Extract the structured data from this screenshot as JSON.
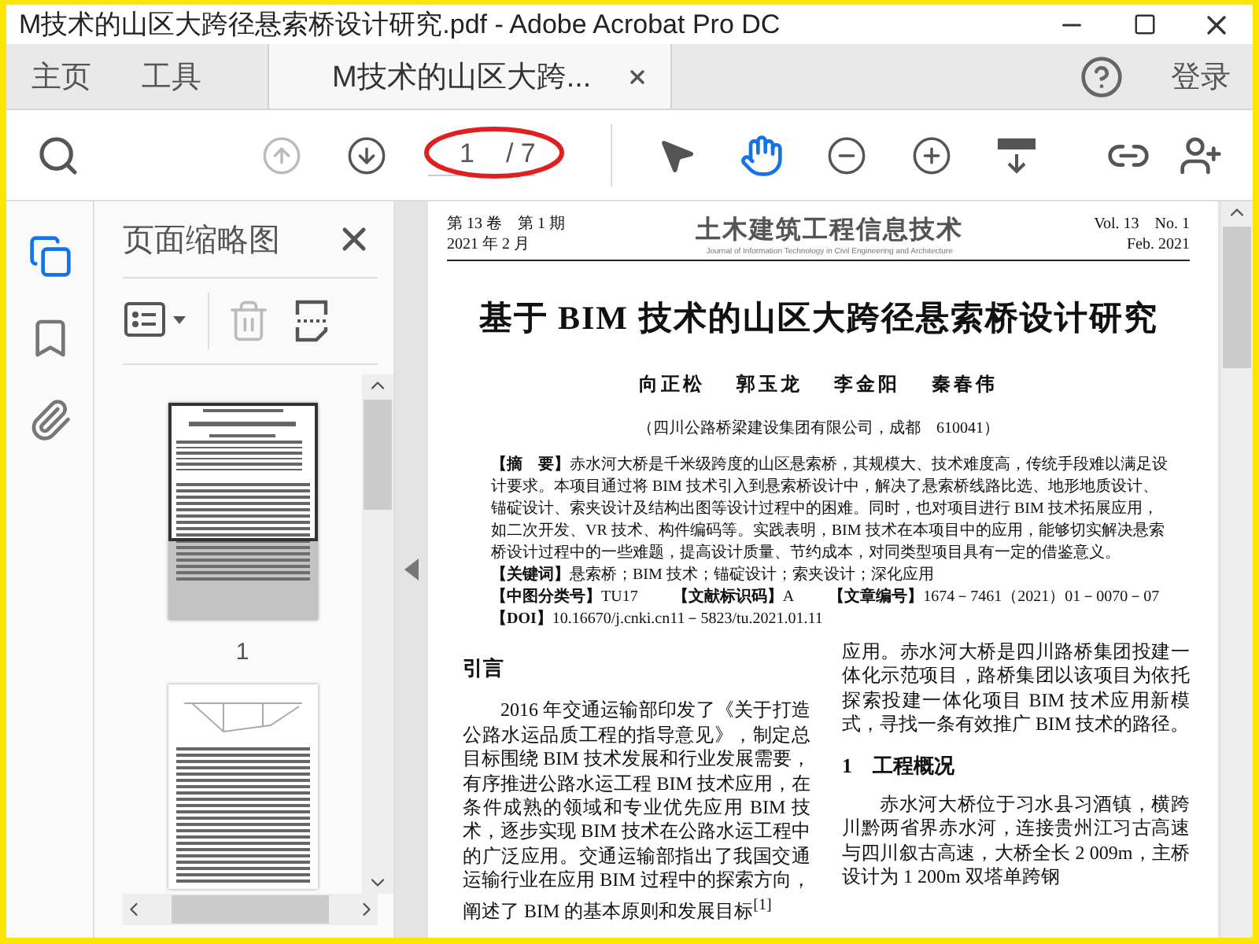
{
  "window": {
    "title": "M技术的山区大跨径悬索桥设计研究.pdf - Adobe Acrobat Pro DC"
  },
  "nav_tabs": [
    {
      "label": "主页",
      "selected": false
    },
    {
      "label": "工具",
      "selected": false
    },
    {
      "label": "M技术的山区大跨...",
      "selected": true
    }
  ],
  "account": {
    "label": "登录"
  },
  "page_navigation": [
    {
      "kind": "previous",
      "disabled": true
    },
    {
      "kind": "next",
      "disabled": false
    }
  ],
  "page_field": {
    "value": "1",
    "count": "/ 7"
  },
  "tools": [
    {
      "kind": "select",
      "selected": false
    },
    {
      "kind": "hand",
      "selected": true
    }
  ],
  "sidebar_tools": [
    {
      "kind": "pages",
      "selected": true
    },
    {
      "kind": "bookmarks",
      "selected": false
    },
    {
      "kind": "attachments",
      "selected": false
    }
  ],
  "thumbnails_panel": {
    "title": "页面缩略图",
    "pages": [
      {
        "kind": "title-page",
        "label": "1",
        "selected": true
      },
      {
        "kind": "figure-page",
        "selected": false
      }
    ]
  },
  "document": {
    "header_left": [
      "第 13 卷　第 1 期",
      "2021 年 2 月"
    ],
    "journal_title": "土木建筑工程信息技术",
    "journal_subtitle": "Journal of Information Technology in Civil Engineering and Architecture",
    "header_right": [
      "Vol. 13　No. 1",
      "Feb. 2021"
    ],
    "title": "基于 BIM 技术的山区大跨径悬索桥设计研究",
    "authors": [
      "向正松",
      "郭玉龙",
      "李金阳",
      "秦春伟"
    ],
    "affiliation": "（四川公路桥梁建设集团有限公司，成都　610041）",
    "abstract": "**【摘　要】**赤水河大桥是千米级跨度的山区悬索桥，其规模大、技术难度高，传统手段难以满足设计要求。本项目通过将 BIM 技术引入到悬索桥设计中，解决了悬索桥线路比选、地形地质设计、锚碇设计、索夹设计及结构出图等设计过程中的困难。同时，也对项目进行 BIM 技术拓展应用，如二次开发、VR 技术、构件编码等。实践表明，BIM 技术在本项目中的应用，能够切实解决悬索桥设计过程中的一些难题，提高设计质量、节约成本，对同类型项目具有一定的借鉴意义。",
    "keywords": "**【关键词】**悬索桥；BIM 技术；锚碇设计；索夹设计；深化应用",
    "classification": [
      "**【中图分类号】**TU17",
      "**【文献标识码】**A",
      "**【文章编号】**1674－7461（2021）01－0070－07"
    ],
    "doi": "**【DOI】**10.16670/j.cnki.cn11－5823/tu.2021.01.11",
    "left_column": {
      "heading": "引言",
      "paragraphs": [
        "2016 年交通运输部印发了《关于打造公路水运品质工程的指导意见》，制定总目标围绕 BIM 技术发展和行业发展需要，有序推进公路水运工程 BIM 技术应用，在条件成熟的领域和专业优先应用 BIM 技术，逐步实现 BIM 技术在公路水运工程中的广泛应用。交通运输部指出了我国交通运输行业在应用 BIM 过程中的探索方向，阐述了 BIM 的基本原则和发展目标$^{[1]}$"
      ]
    },
    "right_column": {
      "lead": "应用。赤水河大桥是四川路桥集团投建一体化示范项目，路桥集团以该项目为依托探索投建一体化项目 BIM 技术应用新模式，寻找一条有效推广 BIM 技术的路径。",
      "heading": "1　工程概况",
      "paragraphs": [
        "赤水河大桥位于习水县习酒镇，横跨川黔两省界赤水河，连接贵州江习古高速与四川叙古高速，大桥全长 2 009m，主桥设计为 1 200m 双塔单跨钢"
      ]
    }
  }
}
